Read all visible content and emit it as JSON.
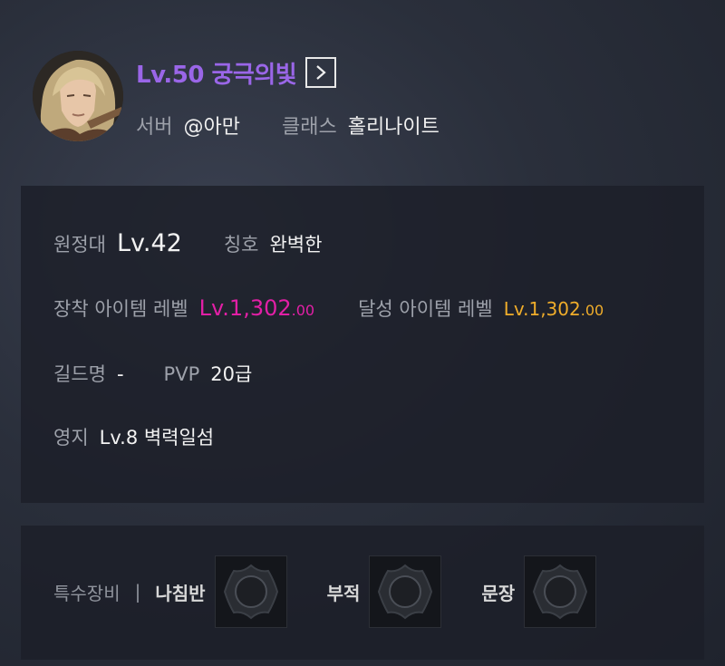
{
  "character": {
    "title": "Lv.50 궁극의빛",
    "server_label": "서버",
    "server_value": "@아만",
    "class_label": "클래스",
    "class_value": "홀리나이트"
  },
  "info": {
    "expedition_label": "원정대",
    "expedition_value": "Lv.42",
    "title_label": "칭호",
    "title_value": "완벽한",
    "equipped_label": "장착 아이템 레벨",
    "equipped_main": "Lv.1,302",
    "equipped_dec": ".00",
    "achieved_label": "달성 아이템 레벨",
    "achieved_main": "Lv.1,302",
    "achieved_dec": ".00",
    "guild_label": "길드명",
    "guild_value": "-",
    "pvp_label": "PVP",
    "pvp_value": "20급",
    "estate_label": "영지",
    "estate_value": "Lv.8 벽력일섬"
  },
  "equipment": {
    "label": "특수장비",
    "separator": "|",
    "items": [
      {
        "name": "나침반",
        "icon": "empty-slot-crest-icon"
      },
      {
        "name": "부적",
        "icon": "empty-slot-crest-icon"
      },
      {
        "name": "문장",
        "icon": "empty-slot-crest-icon"
      }
    ]
  },
  "colors": {
    "title_purple": "#9a66e8",
    "equipped_level_pink": "#e21fa6",
    "achieved_level_gold": "#f0ad2a",
    "label_gray": "#9da1aa"
  }
}
